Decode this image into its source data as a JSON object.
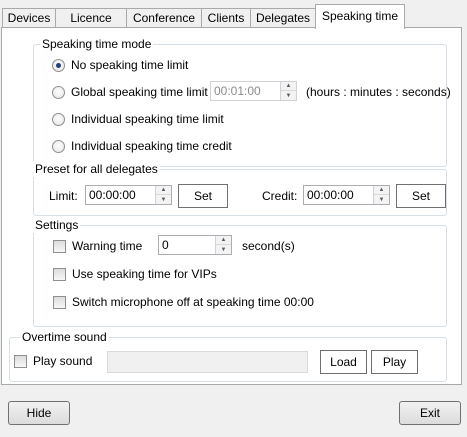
{
  "tabs": [
    {
      "label": "Devices",
      "active": false
    },
    {
      "label": "Licence",
      "active": false
    },
    {
      "label": "Conference",
      "active": false
    },
    {
      "label": "Clients",
      "active": false
    },
    {
      "label": "Delegates",
      "active": false
    },
    {
      "label": "Speaking time",
      "active": true
    }
  ],
  "speaking_mode": {
    "title": "Speaking time mode",
    "options": [
      {
        "label": "No speaking time limit",
        "checked": true
      },
      {
        "label": "Global speaking time limit",
        "checked": false
      },
      {
        "label": "Individual speaking time limit",
        "checked": false
      },
      {
        "label": "Individual speaking time credit",
        "checked": false
      }
    ],
    "global_value": "00:01:00",
    "units": "(hours : minutes : seconds)"
  },
  "preset": {
    "title": "Preset for all delegates",
    "limit_label": "Limit:",
    "limit_value": "00:00:00",
    "set_label": "Set",
    "credit_label": "Credit:",
    "credit_value": "00:00:00",
    "set2_label": "Set"
  },
  "settings": {
    "title": "Settings",
    "warning_label": "Warning time",
    "warning_value": "0",
    "warning_unit": "second(s)",
    "vip_label": "Use speaking time for VIPs",
    "mic_label": "Switch microphone off at speaking time 00:00"
  },
  "overtime": {
    "title": "Overtime sound",
    "play_sound_label": "Play sound",
    "load_label": "Load",
    "play_label": "Play"
  },
  "footer": {
    "hide_label": "Hide",
    "exit_label": "Exit"
  },
  "icons": {
    "spin_up": "▲",
    "spin_down": "▼"
  }
}
